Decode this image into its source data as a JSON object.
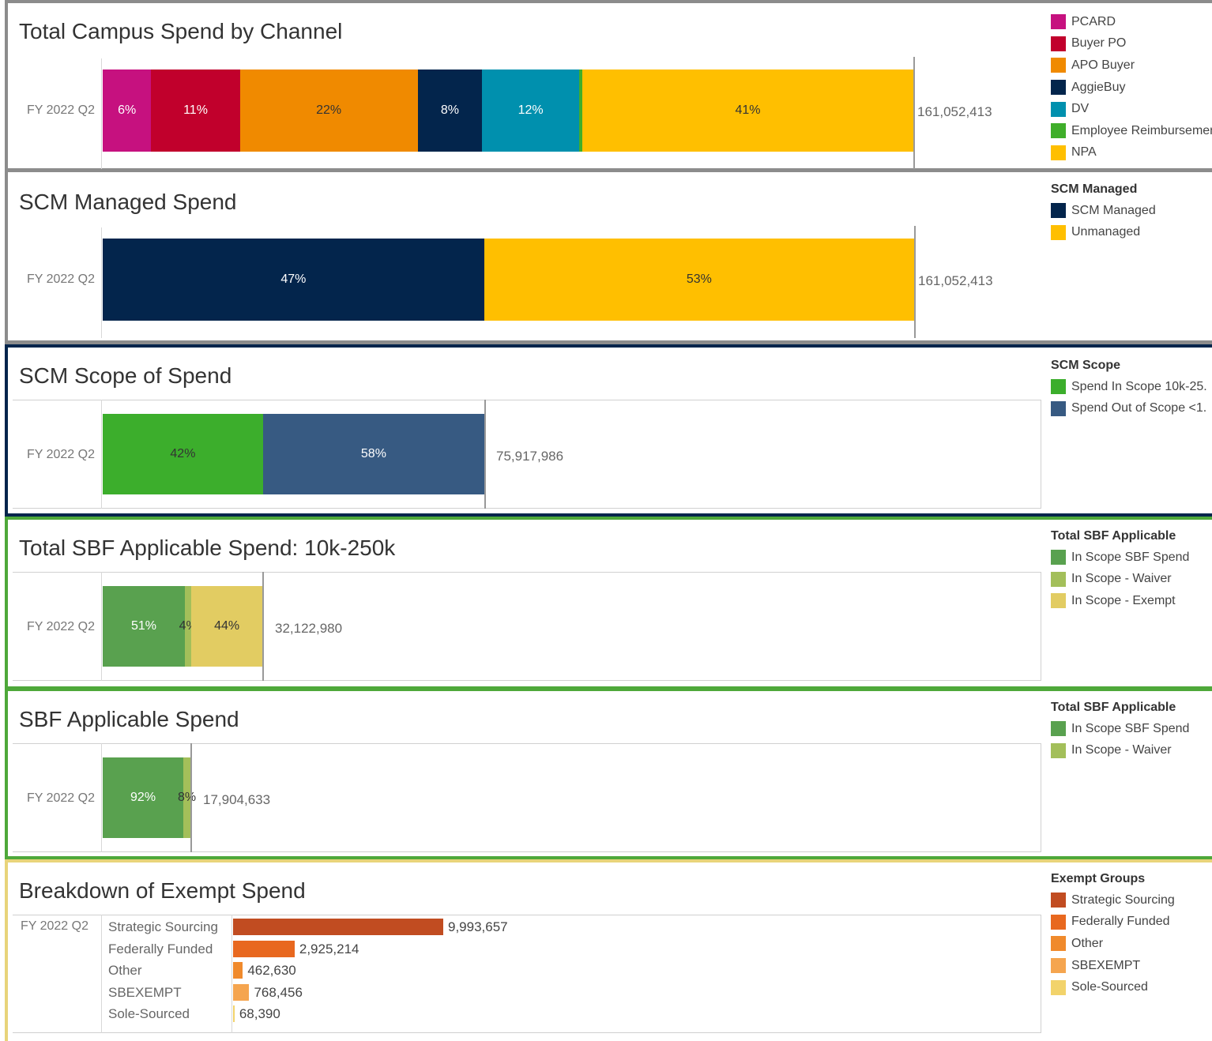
{
  "panels": {
    "channel": {
      "title": "Total Campus Spend by Channel",
      "period": "FY 2022 Q2",
      "total": "161,052,413"
    },
    "managed": {
      "title": "SCM Managed Spend",
      "period": "FY 2022 Q2",
      "total": "161,052,413",
      "legend_title": "SCM Managed"
    },
    "scope": {
      "title": "SCM Scope of Spend",
      "period": "FY 2022 Q2",
      "total": "75,917,986",
      "legend_title": "SCM Scope"
    },
    "sbf_total": {
      "title": "Total SBF Applicable Spend: 10k-250k",
      "period": "FY 2022 Q2",
      "total": "32,122,980",
      "legend_title": "Total SBF Applicable"
    },
    "sbf": {
      "title": "SBF Applicable Spend",
      "period": "FY 2022 Q2",
      "total": "17,904,633",
      "legend_title": "Total SBF Applicable"
    },
    "exempt": {
      "title": "Breakdown of Exempt Spend",
      "period": "FY 2022 Q2",
      "legend_title": "Exempt Groups"
    }
  },
  "chart_data": [
    {
      "type": "bar",
      "title": "Total Campus Spend by Channel",
      "orientation": "horizontal-stacked-percent",
      "categories": [
        "FY 2022 Q2"
      ],
      "total": 161052413,
      "series": [
        {
          "name": "PCARD",
          "values": [
            6
          ],
          "label": "6%",
          "color": "#C6117F",
          "text": "#ffffff"
        },
        {
          "name": "Buyer PO",
          "values": [
            11
          ],
          "label": "11%",
          "color": "#C1002C",
          "text": "#ffffff"
        },
        {
          "name": "APO Buyer",
          "values": [
            22
          ],
          "label": "22%",
          "color": "#F08A00",
          "text": "#333333"
        },
        {
          "name": "AggieBuy",
          "values": [
            8
          ],
          "label": "8%",
          "color": "#03254C",
          "text": "#ffffff"
        },
        {
          "name": "DV",
          "values": [
            12
          ],
          "label": "12%",
          "color": "#0090AE",
          "text": "#ffffff"
        },
        {
          "name": "Employee Reimbursement",
          "values": [
            0.4
          ],
          "label": "",
          "color": "#3FAE2A",
          "text": "#333333"
        },
        {
          "name": "NPA",
          "values": [
            41
          ],
          "label": "41%",
          "color": "#FFBF00",
          "text": "#333333"
        }
      ],
      "legend": "right"
    },
    {
      "type": "bar",
      "title": "SCM Managed Spend",
      "orientation": "horizontal-stacked-percent",
      "categories": [
        "FY 2022 Q2"
      ],
      "total": 161052413,
      "series": [
        {
          "name": "SCM Managed",
          "values": [
            47
          ],
          "label": "47%",
          "color": "#03254C",
          "text": "#ffffff"
        },
        {
          "name": "Unmanaged",
          "values": [
            53
          ],
          "label": "53%",
          "color": "#FFBF00",
          "text": "#333333"
        }
      ],
      "legend": "right"
    },
    {
      "type": "bar",
      "title": "SCM Scope of Spend",
      "orientation": "horizontal-stacked-percent",
      "categories": [
        "FY 2022 Q2"
      ],
      "total": 75917986,
      "series": [
        {
          "name": "Spend In Scope 10k-25.",
          "values": [
            42
          ],
          "label": "42%",
          "color": "#3CAE2C",
          "text": "#333333"
        },
        {
          "name": "Spend Out of Scope <1.",
          "values": [
            58
          ],
          "label": "58%",
          "color": "#375A82",
          "text": "#ffffff"
        }
      ],
      "legend": "right"
    },
    {
      "type": "bar",
      "title": "Total SBF Applicable Spend: 10k-250k",
      "orientation": "horizontal-stacked-percent",
      "categories": [
        "FY 2022 Q2"
      ],
      "total": 32122980,
      "series": [
        {
          "name": "In Scope SBF Spend",
          "values": [
            51
          ],
          "label": "51%",
          "color": "#59A14F",
          "text": "#ffffff"
        },
        {
          "name": "In Scope - Waiver",
          "values": [
            4
          ],
          "label": "4%",
          "color": "#A3BF5A",
          "text": "#333333"
        },
        {
          "name": "In Scope - Exempt",
          "values": [
            44
          ],
          "label": "44%",
          "color": "#E2CC62",
          "text": "#333333"
        }
      ],
      "legend": "right"
    },
    {
      "type": "bar",
      "title": "SBF Applicable Spend",
      "orientation": "horizontal-stacked-percent",
      "categories": [
        "FY 2022 Q2"
      ],
      "total": 17904633,
      "series": [
        {
          "name": "In Scope SBF Spend",
          "values": [
            92
          ],
          "label": "92%",
          "color": "#59A14F",
          "text": "#ffffff"
        },
        {
          "name": "In Scope - Waiver",
          "values": [
            8
          ],
          "label": "8%",
          "color": "#A3BF5A",
          "text": "#333333"
        }
      ],
      "legend": "right"
    },
    {
      "type": "bar",
      "title": "Breakdown of Exempt Spend",
      "orientation": "horizontal",
      "period": "FY 2022 Q2",
      "categories": [
        "Strategic Sourcing",
        "Federally Funded",
        "Other",
        "SBEXEMPT",
        "Sole-Sourced"
      ],
      "values": [
        9993657,
        2925214,
        462630,
        768456,
        68390
      ],
      "labels": [
        "9,993,657",
        "2,925,214",
        "462,630",
        "768,456",
        "68,390"
      ],
      "colors": [
        "#C14C21",
        "#E8681F",
        "#F08A2C",
        "#F5A54F",
        "#F2D36B"
      ],
      "legend": "right"
    }
  ],
  "legend_swatches": {
    "exempt": [
      {
        "name": "Strategic Sourcing",
        "color": "#C14C21"
      },
      {
        "name": "Federally Funded",
        "color": "#E8681F"
      },
      {
        "name": "Other",
        "color": "#F08A2C"
      },
      {
        "name": "SBEXEMPT",
        "color": "#F5A54F"
      },
      {
        "name": "Sole-Sourced",
        "color": "#F2D36B"
      }
    ]
  },
  "colors": {
    "border_gray": "#8C8C8C",
    "border_navy": "#03254C",
    "border_green": "#4EA83A",
    "border_yellow": "#E8D47A"
  }
}
